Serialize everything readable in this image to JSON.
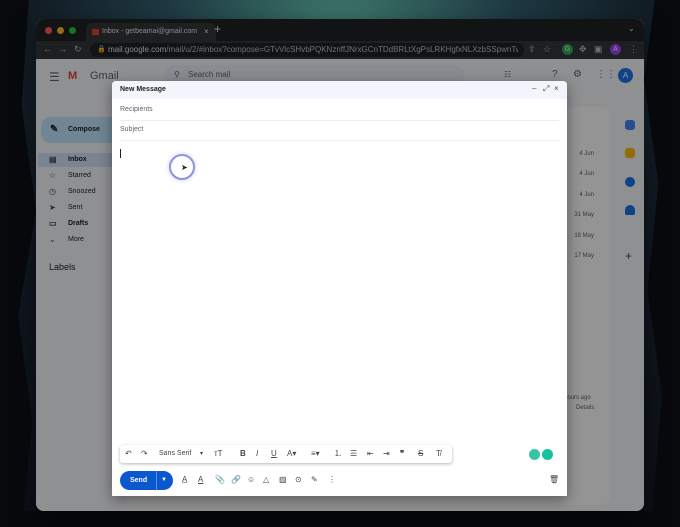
{
  "browser": {
    "tab_title": "Inbox - getbeamai@gmail.com",
    "tab_close": "×",
    "new_tab": "+",
    "tab_menu": "⌄",
    "url_host": "mail.google.com",
    "url_path": "/mail/u/2/#inbox?compose=GTvVlcSHvbPQKNznffJNrxGCnTDdBRLtXgPsLRKHgfxNLXzbSSpwnTwdDhW...",
    "back": "←",
    "forward": "→",
    "reload": "↻",
    "profile_letter": "A"
  },
  "gmail": {
    "app_name": "Gmail",
    "search_placeholder": "Search mail",
    "avatar_letter": "A",
    "compose_label": "Compose",
    "sidebar": [
      {
        "label": "Inbox",
        "icon": "inbox-icon"
      },
      {
        "label": "Starred",
        "icon": "star-icon"
      },
      {
        "label": "Snoozed",
        "icon": "clock-icon"
      },
      {
        "label": "Sent",
        "icon": "send-icon"
      },
      {
        "label": "Drafts",
        "icon": "draft-icon"
      },
      {
        "label": "More",
        "icon": "chevron-down-icon"
      }
    ],
    "labels_heading": "Labels",
    "dates": [
      "4 Jun",
      "4 Jun",
      "4 Jun",
      "31 May",
      "18 May",
      "17 May"
    ],
    "activity_text": "hours ago",
    "details_text": "Details"
  },
  "compose": {
    "title": "New Message",
    "minimize": "–",
    "expand": "⤢",
    "close": "×",
    "recipients_placeholder": "Recipients",
    "subject_placeholder": "Subject",
    "font_name": "Sans Serif",
    "send_label": "Send"
  },
  "colors": {
    "accent": "#0b57d0",
    "compose_button": "#c2e7ff",
    "gmail_red": "#ea4335"
  }
}
